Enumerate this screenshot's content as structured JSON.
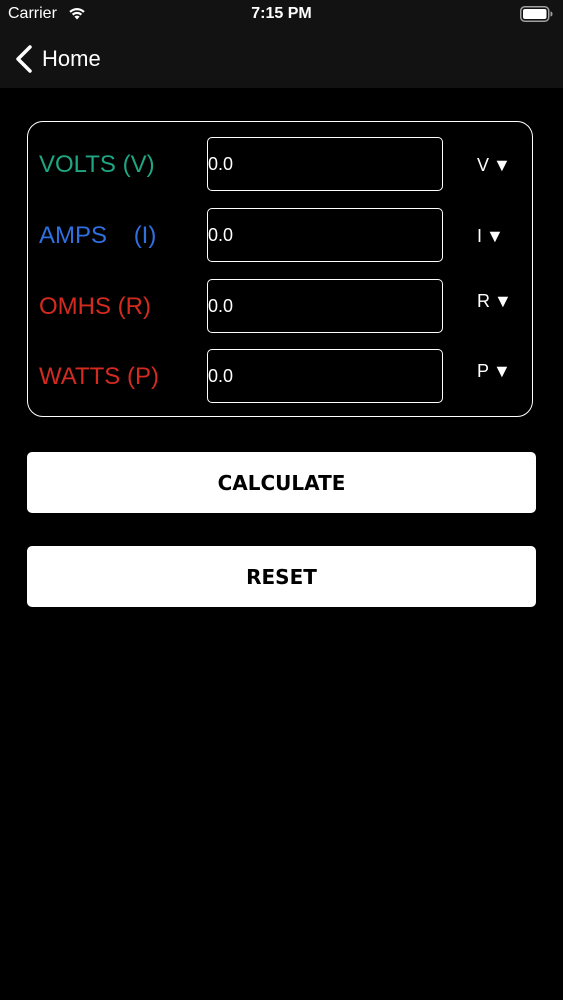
{
  "status_bar": {
    "carrier": "Carrier",
    "time": "7:15 PM"
  },
  "nav": {
    "back_label": "Home"
  },
  "rows": [
    {
      "label": "VOLTS (V)",
      "color": "#1fa582",
      "value": "0.0",
      "unit": "V"
    },
    {
      "label": "AMPS    (I)",
      "color": "#2f6fe0",
      "value": "0.0",
      "unit": "I"
    },
    {
      "label": "OMHS (R)",
      "color": "#d42a20",
      "value": "0.0",
      "unit": "R"
    },
    {
      "label": "WATTS (P)",
      "color": "#d42a20",
      "value": "0.0",
      "unit": "P"
    }
  ],
  "unit_caret": "▼",
  "buttons": {
    "calculate": "CALCULATE",
    "reset": "RESET"
  },
  "colors": {
    "background": "#000000",
    "bar": "#121212",
    "button": "#ffffff"
  }
}
